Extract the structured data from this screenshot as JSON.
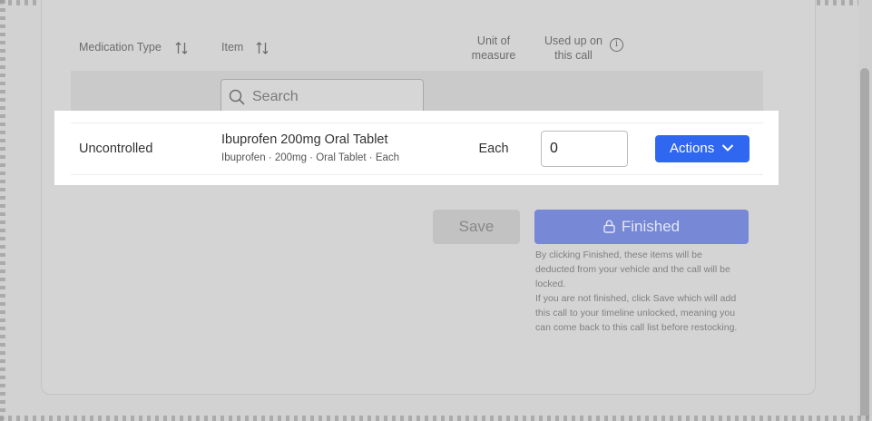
{
  "table": {
    "headers": {
      "medication_type": "Medication Type",
      "item": "Item",
      "unit_line1": "Unit of",
      "unit_line2": "measure",
      "used_line1": "Used up on",
      "used_line2": "this call"
    },
    "icons": {
      "sort": "sort-arrows-icon",
      "info": "info-icon",
      "search": "search-icon"
    },
    "search_placeholder": "Search",
    "rows": [
      {
        "medication_type": "Uncontrolled",
        "item_name": "Ibuprofen 200mg Oral Tablet",
        "item_details": "Ibuprofen · 200mg · Oral Tablet · Each",
        "unit": "Each",
        "used_quantity": "0",
        "actions_label": "Actions"
      }
    ]
  },
  "footer": {
    "save_label": "Save",
    "finished_label": "Finished",
    "note_finished_line1": "By clicking Finished, these items will be",
    "note_finished_line2": "deducted from your vehicle and the call will be",
    "note_finished_line3": "locked.",
    "note_save_line1": "If you are not finished, click Save which will add",
    "note_save_line2": "this call to your timeline unlocked, meaning you",
    "note_save_line3": "can come back to this call list before restocking."
  },
  "colors": {
    "primary": "#2f67f0",
    "finished_disabled": "#7688d6",
    "overlay_background": "#d2d2d2",
    "highlight": "#ffffff"
  }
}
